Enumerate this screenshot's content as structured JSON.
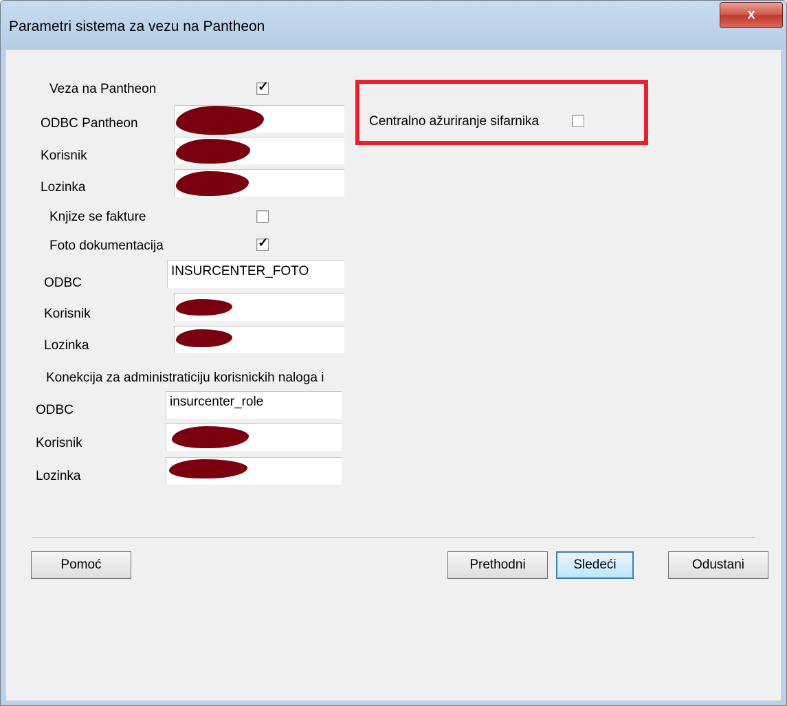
{
  "window": {
    "title": "Parametri sistema za vezu na Pantheon",
    "close_label": "x"
  },
  "pantheon": {
    "veza_label": "Veza na Pantheon",
    "veza_checked": true,
    "odbc_label": "ODBC Pantheon",
    "korisnik_label": "Korisnik",
    "lozinka_label": "Lozinka"
  },
  "fakture": {
    "label": "Knjize se fakture",
    "checked": false
  },
  "foto": {
    "label": "Foto dokumentacija",
    "checked": true,
    "odbc_label": "ODBC",
    "odbc_value": "INSURCENTER_FOTO",
    "korisnik_label": "Korisnik",
    "lozinka_label": "Lozinka"
  },
  "admin": {
    "heading": "Konekcija za administraticiju korisnickih naloga i",
    "odbc_label": "ODBC",
    "odbc_value": "insurcenter_role",
    "korisnik_label": "Korisnik",
    "lozinka_label": "Lozinka"
  },
  "central": {
    "label": "Centralno ažuriranje sifarnika",
    "checked": false
  },
  "buttons": {
    "help": "Pomoć",
    "prev": "Prethodni",
    "next": "Sledeći",
    "cancel": "Odustani"
  }
}
